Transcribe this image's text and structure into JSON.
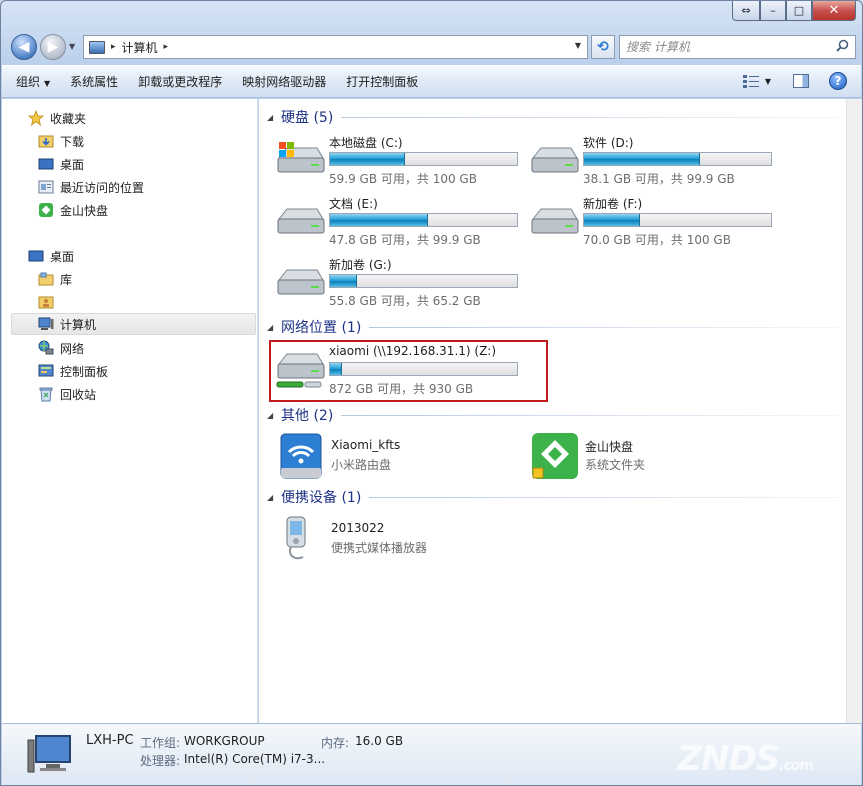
{
  "window": {
    "caption": {
      "restore": "⇔",
      "minimize": "–",
      "maximize": "□",
      "close": "✕"
    }
  },
  "address": {
    "crumb": "计算机",
    "separator": "▸"
  },
  "search": {
    "placeholder": "搜索 计算机"
  },
  "toolbar": {
    "organize": "组织",
    "system_properties": "系统属性",
    "uninstall": "卸载或更改程序",
    "map_drive": "映射网络驱动器",
    "control_panel": "打开控制面板",
    "help": "?"
  },
  "nav": {
    "favorites": "收藏夹",
    "downloads": "下载",
    "desktop_fav": "桌面",
    "recent": "最近访问的位置",
    "kingsoft": "金山快盘",
    "desktop": "桌面",
    "libraries": "库",
    "computer": "计算机",
    "network": "网络",
    "control_panel": "控制面板",
    "recycle": "回收站"
  },
  "groups": {
    "hard_disks": "硬盘 (5)",
    "network_locations": "网络位置 (1)",
    "other": "其他 (2)",
    "portable": "便携设备 (1)"
  },
  "drives": [
    {
      "name": "本地磁盘 (C:)",
      "info": "59.9 GB 可用，共 100 GB",
      "used_fraction": 0.401,
      "system": true
    },
    {
      "name": "软件 (D:)",
      "info": "38.1 GB 可用，共 99.9 GB",
      "used_fraction": 0.619
    },
    {
      "name": "文档 (E:)",
      "info": "47.8 GB 可用，共 99.9 GB",
      "used_fraction": 0.522
    },
    {
      "name": "新加卷 (F:)",
      "info": "70.0 GB 可用，共 100 GB",
      "used_fraction": 0.3
    },
    {
      "name": "新加卷 (G:)",
      "info": "55.8 GB 可用，共 65.2 GB",
      "used_fraction": 0.144
    }
  ],
  "network_drive": {
    "name": "xiaomi (\\\\192.168.31.1) (Z:)",
    "info": "872 GB 可用，共 930 GB",
    "used_fraction": 0.062
  },
  "other_items": [
    {
      "name": "Xiaomi_kfts",
      "sub": "小米路由盘"
    },
    {
      "name": "金山快盘",
      "sub": "系统文件夹"
    }
  ],
  "portable_item": {
    "name": "2013022",
    "sub": "便携式媒体播放器"
  },
  "details": {
    "pc_name": "LXH-PC",
    "workgroup_label": "工作组:",
    "workgroup": "WORKGROUP",
    "memory_label": "内存:",
    "memory": "16.0 GB",
    "cpu_label": "处理器:",
    "cpu": "Intel(R) Core(TM) i7-3..."
  },
  "watermark": {
    "main": "ZNDS",
    "suffix": ".com"
  },
  "colors": {
    "accent": "#26a0da",
    "group_title": "#1e3287",
    "highlight": "#c31b1b"
  }
}
